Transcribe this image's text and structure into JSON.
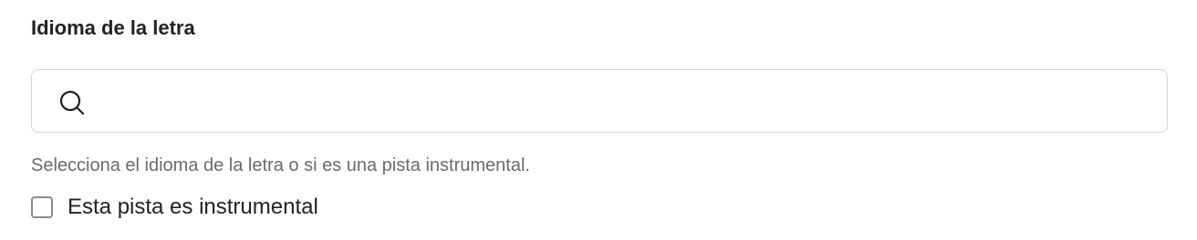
{
  "field": {
    "label": "Idioma de la letra",
    "search": {
      "value": "",
      "placeholder": "",
      "icon": "search-icon"
    },
    "helper_text": "Selecciona el idioma de la letra o si es una pista instrumental."
  },
  "instrumental": {
    "label": "Esta pista es instrumental",
    "checked": false
  }
}
